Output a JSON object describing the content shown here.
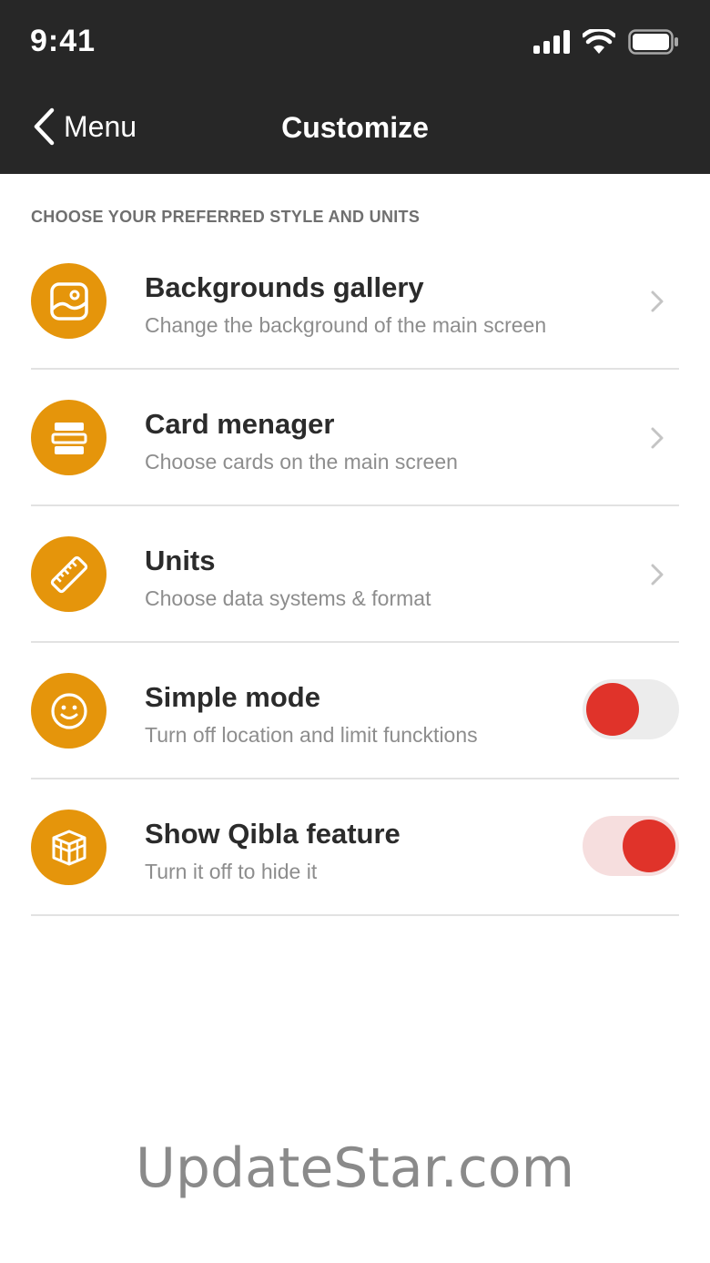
{
  "status_bar": {
    "time": "9:41"
  },
  "nav": {
    "back_label": "Menu",
    "title": "Customize"
  },
  "section": {
    "title": "CHOOSE YOUR PREFERRED STYLE AND UNITS"
  },
  "colors": {
    "header_bg": "#272727",
    "accent_orange": "#e5950b",
    "toggle_red": "#e0332a"
  },
  "items": [
    {
      "title": "Backgrounds gallery",
      "subtitle": "Change the background of the main screen",
      "icon": "image-icon",
      "control": "chevron"
    },
    {
      "title": "Card menager",
      "subtitle": "Choose cards on the main screen",
      "icon": "cards-icon",
      "control": "chevron"
    },
    {
      "title": "Units",
      "subtitle": "Choose data systems & format",
      "icon": "ruler-icon",
      "control": "chevron"
    },
    {
      "title": "Simple mode",
      "subtitle": "Turn off location and limit funcktions",
      "icon": "smiley-icon",
      "control": "toggle",
      "toggle_on": false
    },
    {
      "title": "Show Qibla feature",
      "subtitle": "Turn it off to hide it",
      "icon": "kaaba-icon",
      "control": "toggle",
      "toggle_on": true
    }
  ],
  "watermark": "UpdateStar.com"
}
